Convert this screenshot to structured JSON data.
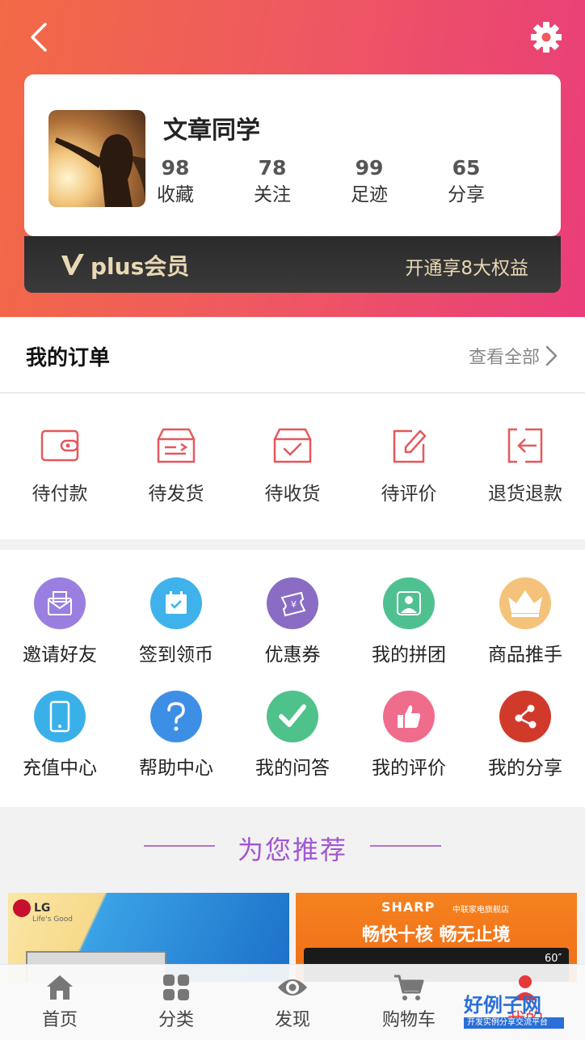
{
  "profile": {
    "username": "文章同学",
    "stats": [
      {
        "value": "98",
        "label": "收藏"
      },
      {
        "value": "78",
        "label": "关注"
      },
      {
        "value": "99",
        "label": "足迹"
      },
      {
        "value": "65",
        "label": "分享"
      }
    ]
  },
  "plus": {
    "label": "plus会员",
    "offer": "开通享8大权益"
  },
  "orders": {
    "title": "我的订单",
    "view_all": "查看全部",
    "items": [
      {
        "label": "待付款",
        "icon": "wallet-icon"
      },
      {
        "label": "待发货",
        "icon": "shipping-box-icon"
      },
      {
        "label": "待收货",
        "icon": "receive-box-icon"
      },
      {
        "label": "待评价",
        "icon": "edit-review-icon"
      },
      {
        "label": "退货退款",
        "icon": "return-icon"
      }
    ]
  },
  "tools": {
    "items": [
      {
        "label": "邀请好友",
        "icon": "invite-envelope-icon",
        "color": "#9b7fe0"
      },
      {
        "label": "签到领币",
        "icon": "calendar-check-icon",
        "color": "#3fb2ec"
      },
      {
        "label": "优惠券",
        "icon": "coupon-icon",
        "color": "#8a6cc4"
      },
      {
        "label": "我的拼团",
        "icon": "group-buy-icon",
        "color": "#4fc191"
      },
      {
        "label": "商品推手",
        "icon": "crown-icon",
        "color": "#f4c27a"
      },
      {
        "label": "充值中心",
        "icon": "phone-icon",
        "color": "#3ab0e8"
      },
      {
        "label": "帮助中心",
        "icon": "help-icon",
        "color": "#3d8fe6"
      },
      {
        "label": "我的问答",
        "icon": "check-icon",
        "color": "#4fc18a"
      },
      {
        "label": "我的评价",
        "icon": "thumbs-up-icon",
        "color": "#f06c8c"
      },
      {
        "label": "我的分享",
        "icon": "share-icon",
        "color": "#d13a2b"
      }
    ]
  },
  "recommend": {
    "title": "为您推荐"
  },
  "banners": {
    "lg": {
      "brand": "LG",
      "tagline": "Life's Good"
    },
    "sharp": {
      "brand": "SHARP",
      "store": "中联家电旗舰店",
      "slogan": "畅快十核 畅无止境",
      "size": "60″"
    }
  },
  "tabbar": {
    "items": [
      {
        "label": "首页",
        "icon": "home-icon"
      },
      {
        "label": "分类",
        "icon": "category-grid-icon"
      },
      {
        "label": "发现",
        "icon": "discover-eye-icon"
      },
      {
        "label": "购物车",
        "icon": "cart-icon"
      },
      {
        "label": "我的",
        "icon": "user-icon"
      }
    ],
    "active_color": "#e5383b"
  },
  "watermark": {
    "badge_title": "好例子网",
    "badge_sub": "开发实例分享交流平台"
  },
  "colors": {
    "header_start": "#f26a45",
    "header_end": "#e93d7a",
    "order_icon": "#e5585c",
    "plus_gold": "#e8d8b4"
  }
}
